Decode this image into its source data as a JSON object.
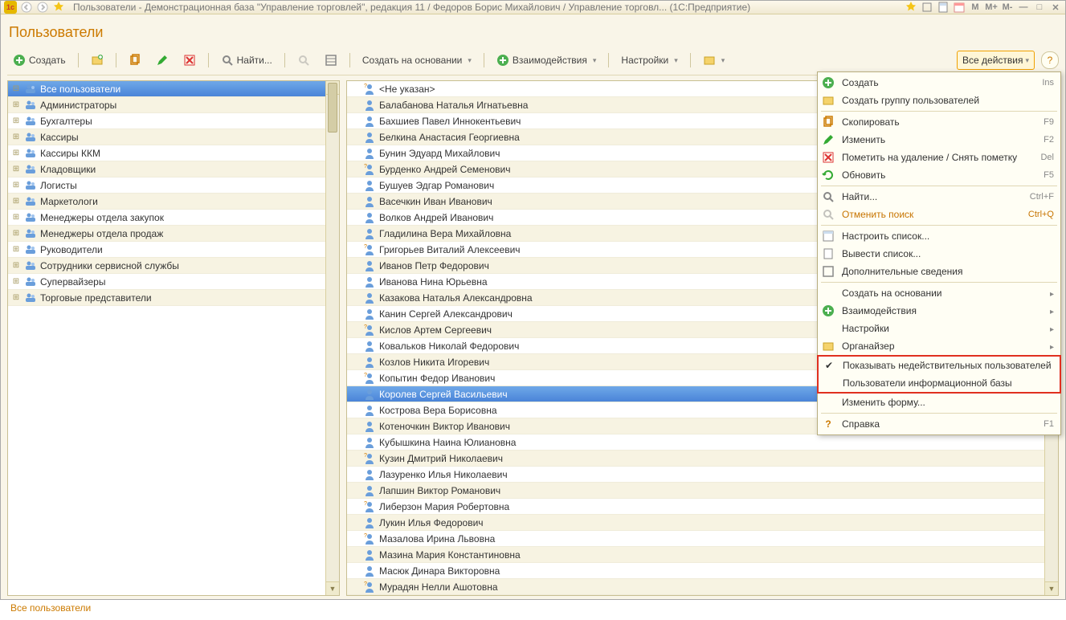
{
  "titlebar": {
    "title": "Пользователи - Демонстрационная база \"Управление торговлей\", редакция 11 / Федоров Борис Михайлович / Управление торговл... (1С:Предприятие)",
    "buttons": {
      "m": "M",
      "mplus": "M+",
      "mminus": "M-"
    }
  },
  "page_title": "Пользователи",
  "toolbar": {
    "create": "Создать",
    "find": "Найти...",
    "create_based": "Создать на основании",
    "interactions": "Взаимодействия",
    "settings": "Настройки",
    "all_actions": "Все действия"
  },
  "groups": [
    {
      "label": "Все пользователи",
      "sel": true
    },
    {
      "label": "Администраторы"
    },
    {
      "label": "Бухгалтеры"
    },
    {
      "label": "Кассиры"
    },
    {
      "label": "Кассиры ККМ"
    },
    {
      "label": "Кладовщики"
    },
    {
      "label": "Логисты"
    },
    {
      "label": "Маркетологи"
    },
    {
      "label": "Менеджеры отдела закупок"
    },
    {
      "label": "Менеджеры отдела продаж"
    },
    {
      "label": "Руководители"
    },
    {
      "label": "Сотрудники сервисной службы"
    },
    {
      "label": "Супервайзеры"
    },
    {
      "label": "Торговые представители"
    }
  ],
  "users": [
    {
      "label": "<Не указан>",
      "q": true
    },
    {
      "label": "Балабанова Наталья Игнатьевна"
    },
    {
      "label": "Бахшиев Павел Иннокентьевич"
    },
    {
      "label": "Белкина Анастасия Георгиевна"
    },
    {
      "label": "Бунин Эдуард Михайлович"
    },
    {
      "label": "Бурденко Андрей Семенович",
      "q": true
    },
    {
      "label": "Бушуев Эдгар Романович"
    },
    {
      "label": "Васечкин Иван Иванович"
    },
    {
      "label": "Волков Андрей Иванович"
    },
    {
      "label": "Гладилина Вера Михайловна"
    },
    {
      "label": "Григорьев Виталий Алексеевич",
      "q": true
    },
    {
      "label": "Иванов Петр Федорович"
    },
    {
      "label": "Иванова Нина Юрьевна"
    },
    {
      "label": "Казакова Наталья Александровна"
    },
    {
      "label": "Канин Сергей Александрович"
    },
    {
      "label": "Кислов Артем Сергеевич",
      "q": true
    },
    {
      "label": "Ковальков Николай Федорович"
    },
    {
      "label": "Козлов Никита Игоревич"
    },
    {
      "label": "Копытин Федор Иванович",
      "q": true
    },
    {
      "label": "Королев Сергей Васильевич",
      "sel": true
    },
    {
      "label": "Кострова Вера Борисовна"
    },
    {
      "label": "Котеночкин Виктор Иванович"
    },
    {
      "label": "Кубышкина Наина Юлиановна"
    },
    {
      "label": "Кузин Дмитрий Николаевич",
      "q": true
    },
    {
      "label": "Лазуренко Илья Николаевич"
    },
    {
      "label": "Лапшин Виктор Романович"
    },
    {
      "label": "Либерзон Мария Робертовна",
      "q": true
    },
    {
      "label": "Лукин Илья Федорович"
    },
    {
      "label": "Мазалова Ирина Львовна",
      "q": true
    },
    {
      "label": "Мазина Мария Константиновна"
    },
    {
      "label": "Масюк Динара Викторовна"
    },
    {
      "label": "Мурадян Нелли Ашотовна",
      "q": true
    }
  ],
  "footer": "Все пользователи",
  "menu": {
    "create": {
      "label": "Создать",
      "sc": "Ins"
    },
    "create_group": {
      "label": "Создать группу пользователей"
    },
    "copy": {
      "label": "Скопировать",
      "sc": "F9"
    },
    "edit": {
      "label": "Изменить",
      "sc": "F2"
    },
    "mark_delete": {
      "label": "Пометить на удаление / Снять пометку",
      "sc": "Del"
    },
    "refresh": {
      "label": "Обновить",
      "sc": "F5"
    },
    "find": {
      "label": "Найти...",
      "sc": "Ctrl+F"
    },
    "cancel_find": {
      "label": "Отменить поиск",
      "sc": "Ctrl+Q"
    },
    "configure_list": {
      "label": "Настроить список..."
    },
    "output_list": {
      "label": "Вывести список..."
    },
    "extra_info": {
      "label": "Дополнительные сведения"
    },
    "create_based": {
      "label": "Создать на основании"
    },
    "interactions": {
      "label": "Взаимодействия"
    },
    "settings": {
      "label": "Настройки"
    },
    "organizer": {
      "label": "Органайзер"
    },
    "show_invalid": {
      "label": "Показывать недействительных пользователей"
    },
    "ib_users": {
      "label": "Пользователи информационной базы"
    },
    "change_form": {
      "label": "Изменить форму..."
    },
    "help": {
      "label": "Справка",
      "sc": "F1"
    }
  }
}
